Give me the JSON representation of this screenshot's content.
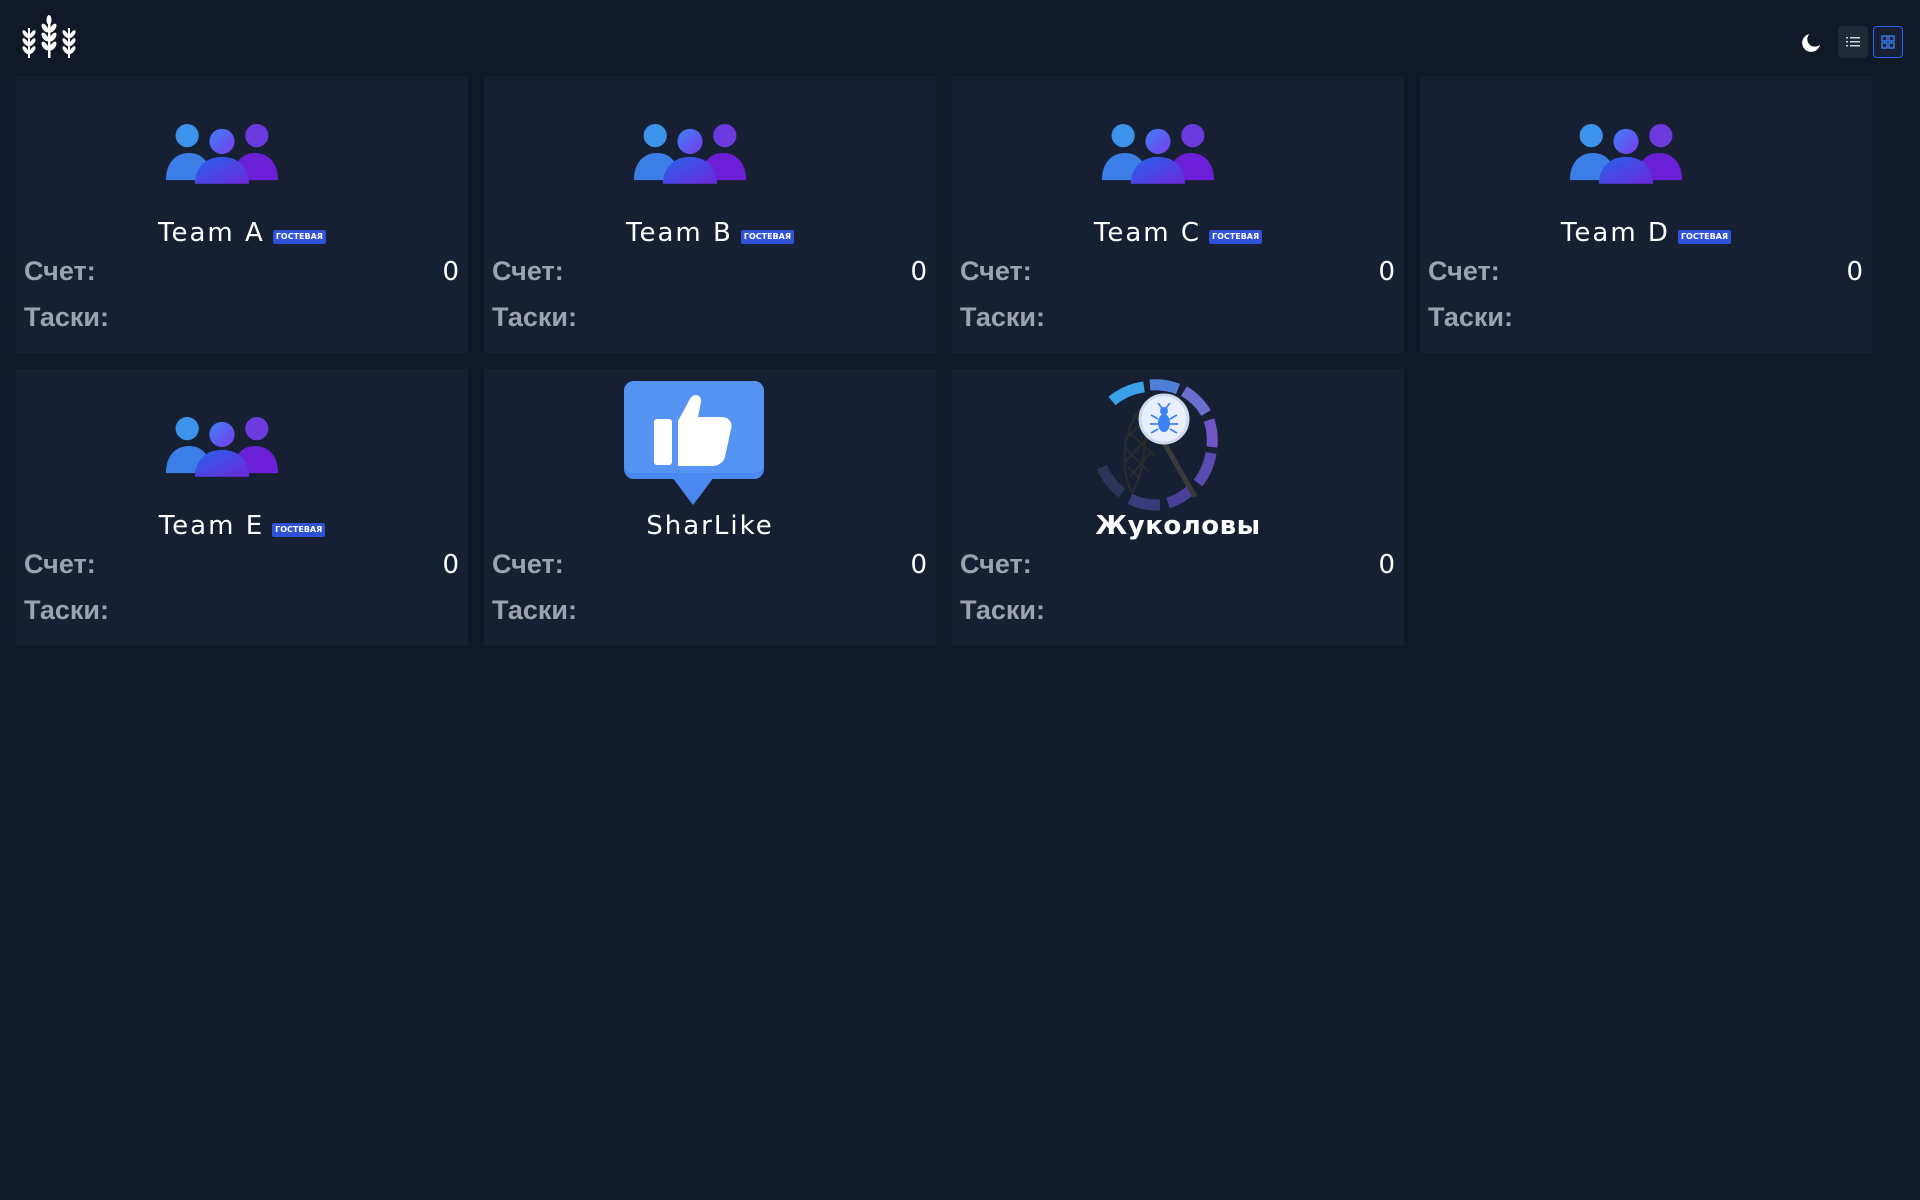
{
  "header": {
    "logo_icon": "wheat-logo-icon",
    "theme_toggle_icon": "moon-icon",
    "view_list_icon": "list-icon",
    "view_grid_icon": "grid-icon",
    "active_view": "grid"
  },
  "labels": {
    "score": "Счет:",
    "tasks": "Таски:"
  },
  "colors": {
    "background": "#111827",
    "card": "#172033",
    "badge": "#2f52d6",
    "accent": "#2563eb"
  },
  "teams": [
    {
      "name": "Team A",
      "badge": "ГОСТЕВАЯ",
      "score": "0",
      "avatar_icon": "users-group-icon"
    },
    {
      "name": "Team B",
      "badge": "ГОСТЕВАЯ",
      "score": "0",
      "avatar_icon": "users-group-icon"
    },
    {
      "name": "Team C",
      "badge": "ГОСТЕВАЯ",
      "score": "0",
      "avatar_icon": "users-group-icon"
    },
    {
      "name": "Team D",
      "badge": "ГОСТЕВАЯ",
      "score": "0",
      "avatar_icon": "users-group-icon"
    },
    {
      "name": "Team E",
      "badge": "ГОСТЕВАЯ",
      "score": "0",
      "avatar_icon": "users-group-icon"
    },
    {
      "name": "SharLike",
      "score": "0",
      "avatar_icon": "thumbs-up-icon"
    },
    {
      "name": "Жуколовы",
      "score": "0",
      "avatar_icon": "bug-net-icon"
    }
  ]
}
